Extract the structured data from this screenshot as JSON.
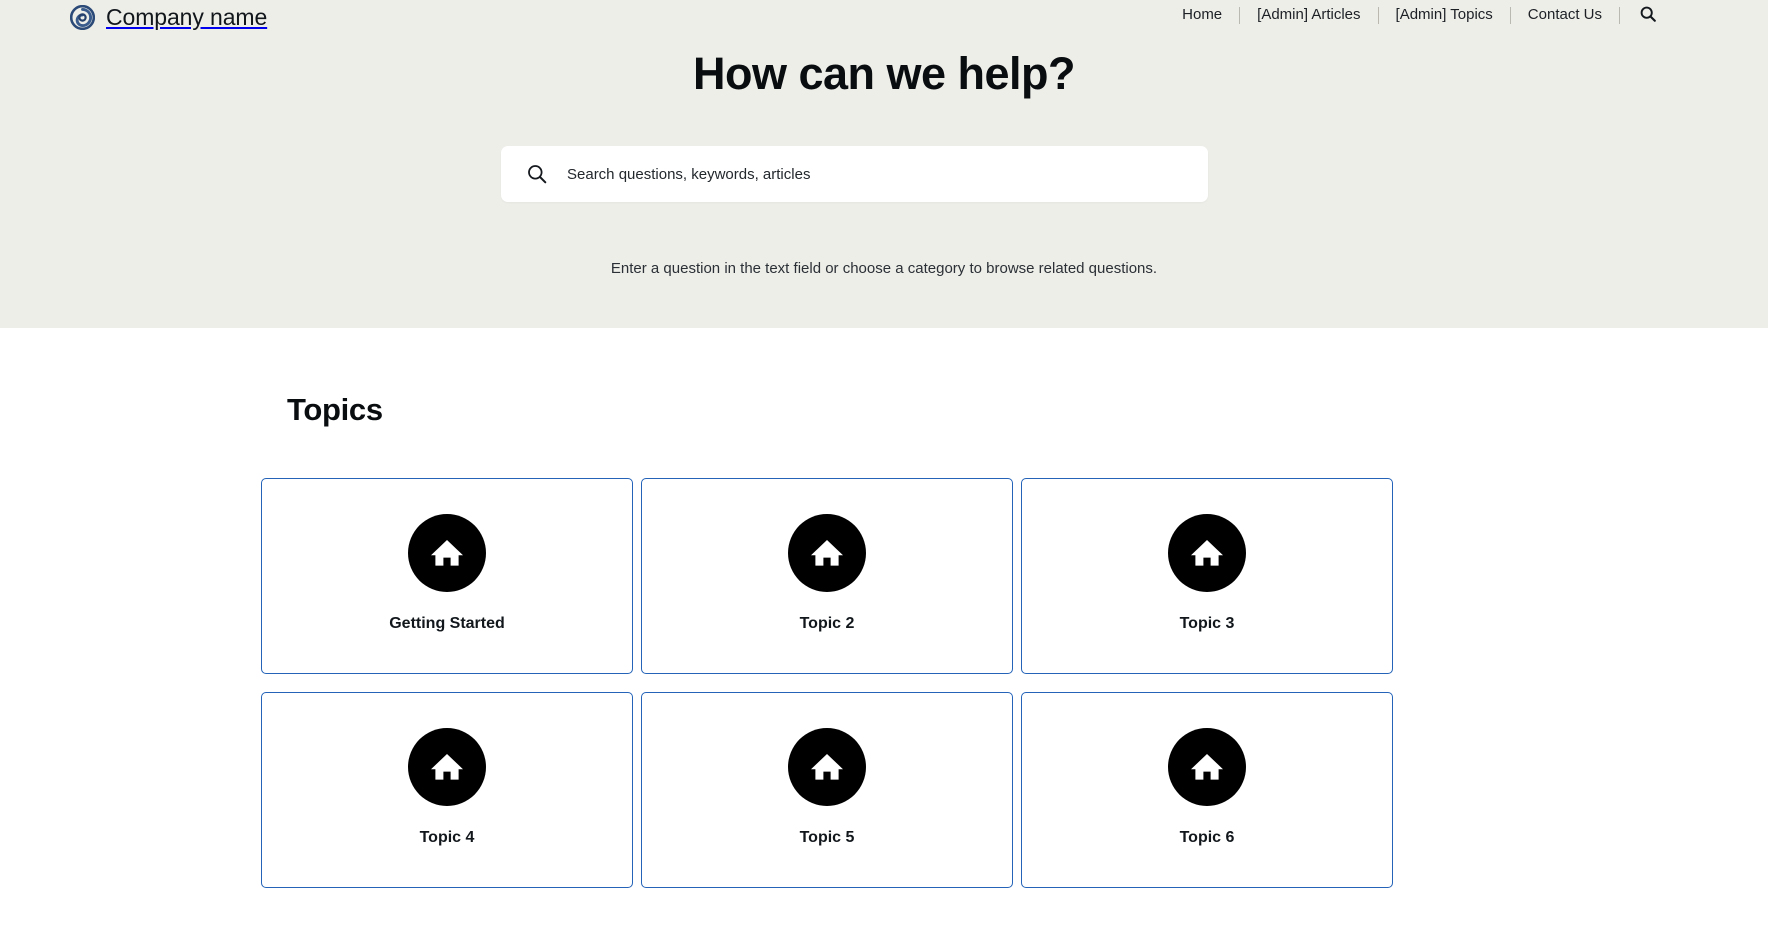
{
  "header": {
    "logo_icon": "spiral-circle-logo",
    "logo_color": "#2b4a77",
    "brand_name": "Company name",
    "nav_items": [
      {
        "label": "Home"
      },
      {
        "label": "[Admin] Articles"
      },
      {
        "label": "[Admin] Topics"
      },
      {
        "label": "Contact Us"
      }
    ],
    "search_icon": "search-icon"
  },
  "hero": {
    "background_color": "#eeeee9",
    "title": "How can we help?",
    "search": {
      "icon": "search-icon",
      "placeholder": "Search questions, keywords, articles",
      "value": ""
    },
    "subtitle": "Enter a question in the text field or choose a category to browse related questions."
  },
  "topics": {
    "heading": "Topics",
    "card_border_color": "#2463b8",
    "icon_name": "home-icon",
    "cards": [
      {
        "label": "Getting Started",
        "icon": "home-icon"
      },
      {
        "label": "Topic 2",
        "icon": "home-icon"
      },
      {
        "label": "Topic 3",
        "icon": "home-icon"
      },
      {
        "label": "Topic 4",
        "icon": "home-icon"
      },
      {
        "label": "Topic 5",
        "icon": "home-icon"
      },
      {
        "label": "Topic 6",
        "icon": "home-icon"
      }
    ]
  }
}
